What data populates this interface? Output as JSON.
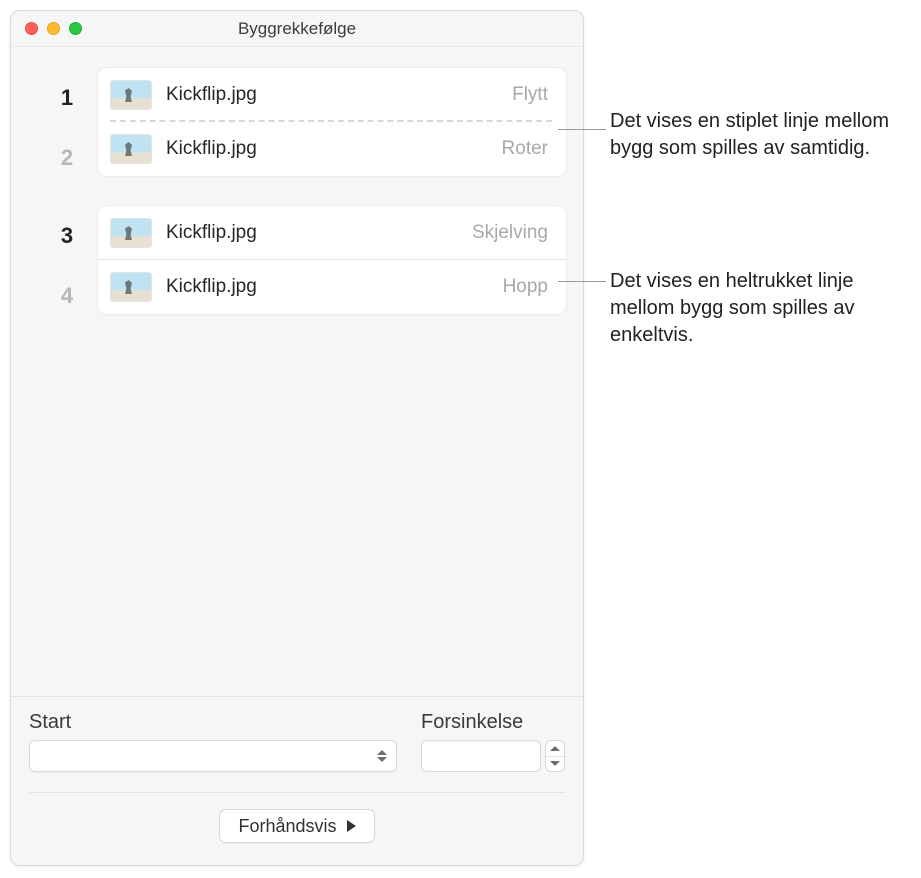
{
  "window": {
    "title": "Byggrekkefølge"
  },
  "builds": {
    "group1": [
      {
        "num": "1",
        "file": "Kickflip.jpg",
        "action": "Flytt",
        "numDim": false
      },
      {
        "num": "2",
        "file": "Kickflip.jpg",
        "action": "Roter",
        "numDim": true
      }
    ],
    "group2": [
      {
        "num": "3",
        "file": "Kickflip.jpg",
        "action": "Skjelving",
        "numDim": false
      },
      {
        "num": "4",
        "file": "Kickflip.jpg",
        "action": "Hopp",
        "numDim": true
      }
    ]
  },
  "controls": {
    "start_label": "Start",
    "delay_label": "Forsinkelse",
    "start_value": "",
    "delay_value": "",
    "preview_label": "Forhåndsvis"
  },
  "callouts": {
    "c1": "Det vises en stiplet linje mellom bygg som spilles av samtidig.",
    "c2": "Det vises en heltrukket linje mellom bygg som spilles av enkeltvis."
  }
}
